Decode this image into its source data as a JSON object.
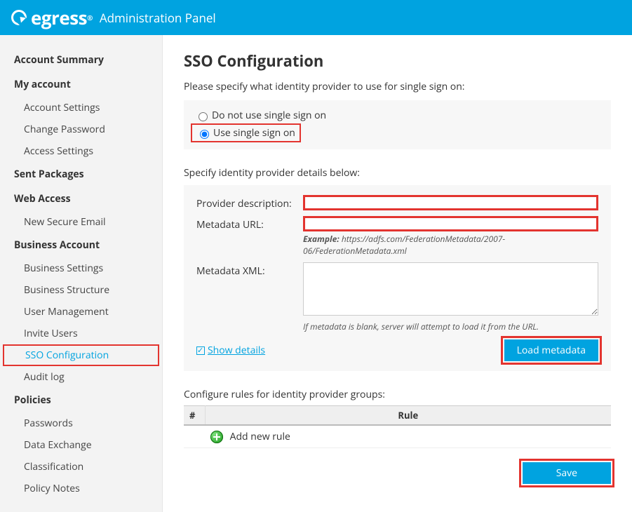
{
  "brand": {
    "name": "egress",
    "panel": "Administration Panel"
  },
  "sidebar": {
    "account_summary": "Account Summary",
    "my_account": {
      "heading": "My account",
      "items": [
        "Account Settings",
        "Change Password",
        "Access Settings"
      ]
    },
    "sent_packages": "Sent Packages",
    "web_access": {
      "heading": "Web Access",
      "items": [
        "New Secure Email"
      ]
    },
    "business_account": {
      "heading": "Business Account",
      "items": [
        "Business Settings",
        "Business Structure",
        "User Management",
        "Invite Users",
        "SSO Configuration",
        "Audit log"
      ]
    },
    "policies": {
      "heading": "Policies",
      "items": [
        "Passwords",
        "Data Exchange",
        "Classification",
        "Policy Notes"
      ]
    }
  },
  "page": {
    "title": "SSO Configuration",
    "intro": "Please specify what identity provider to use for single sign on:",
    "radio": {
      "off_label": "Do not use single sign on",
      "on_label": "Use single sign on",
      "selected": "on"
    },
    "details_prompt": "Specify identity provider details below:",
    "fields": {
      "provider_label": "Provider description:",
      "provider_value": "",
      "metadata_url_label": "Metadata URL:",
      "metadata_url_value": "",
      "metadata_url_example_prefix": "Example:",
      "metadata_url_example": "https://adfs.com/FederationMetadata/2007-06/FederationMetadata.xml",
      "metadata_xml_label": "Metadata XML:",
      "metadata_xml_value": "",
      "metadata_xml_hint": "If metadata is blank, server will attempt to load it from the URL."
    },
    "show_details": "Show details",
    "load_button": "Load metadata",
    "rules_prompt": "Configure rules for identity provider groups:",
    "table": {
      "col_index": "#",
      "col_rule": "Rule",
      "add_label": "Add new rule"
    },
    "save_button": "Save"
  }
}
